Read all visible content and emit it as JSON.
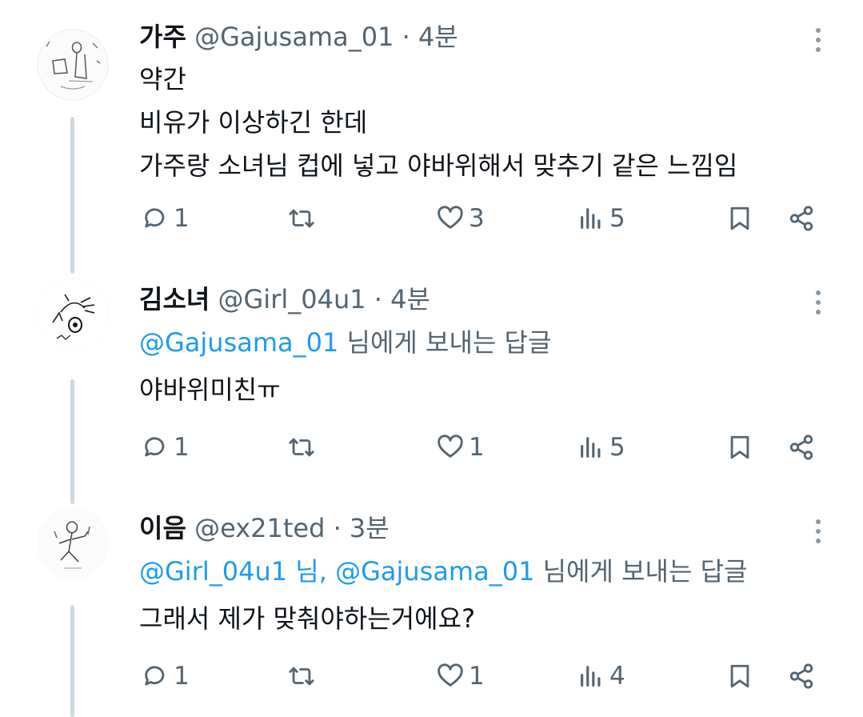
{
  "tweets": [
    {
      "name": "가주",
      "handle": "@Gajusama_01",
      "separator": "·",
      "time": "4분",
      "reply_to": null,
      "lines": [
        "약간",
        "비유가 이상하긴 한데",
        "가주랑 소녀님 컵에 넣고 야바위해서 맞추기 같은 느낌임"
      ],
      "replies": "1",
      "retweets": "",
      "likes": "3",
      "views": "5"
    },
    {
      "name": "김소녀",
      "handle": "@Girl_04u1",
      "separator": "·",
      "time": "4분",
      "reply_to": {
        "mentions": "@Gajusama_01",
        "suffix": " 님에게 보내는 답글"
      },
      "lines": [
        "야바위미친ㅠ"
      ],
      "replies": "1",
      "retweets": "",
      "likes": "1",
      "views": "5"
    },
    {
      "name": "이음",
      "handle": "@ex21ted",
      "separator": "·",
      "time": "3분",
      "reply_to": {
        "mention1": "@Girl_04u1",
        "mid": " 님, ",
        "mention2": "@Gajusama_01",
        "suffix": " 님에게 보내는 답글"
      },
      "lines": [
        "그래서 제가 맞춰야하는거에요?"
      ],
      "replies": "1",
      "retweets": "",
      "likes": "1",
      "views": "4"
    }
  ],
  "icons": {
    "reply": "reply-icon",
    "retweet": "retweet-icon",
    "like": "heart-icon",
    "views": "views-icon",
    "bookmark": "bookmark-icon",
    "share": "share-icon",
    "more": "more-icon"
  },
  "colors": {
    "link": "#1d9bf0",
    "muted": "#536471",
    "text": "#0f1419",
    "thread_line": "#cfd9de"
  }
}
